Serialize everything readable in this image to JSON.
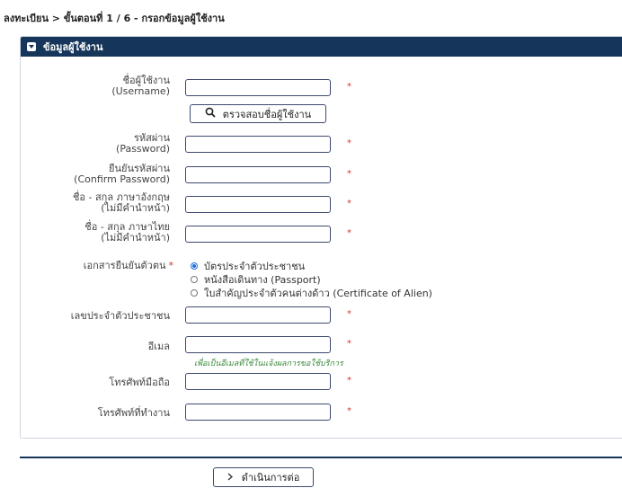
{
  "breadcrumb": "ลงทะเบียน > ขั้นตอนที่ 1 / 6 - กรอกข้อมูลผู้ใช้งาน",
  "panel": {
    "title": "ข้อมูลผู้ใช้งาน"
  },
  "fields": {
    "username": {
      "label_th": "ชื่อผู้ใช้งาน",
      "label_en": "(Username)",
      "value": ""
    },
    "check_button": "ตรวจสอบชื่อผู้ใช้งาน",
    "password": {
      "label_th": "รหัสผ่าน",
      "label_en": "(Password)",
      "value": ""
    },
    "confirm_password": {
      "label_th": "ยืนยันรหัสผ่าน",
      "label_en": "(Confirm Password)",
      "value": ""
    },
    "name_en": {
      "label_1": "ชื่อ - สกุล ภาษาอังกฤษ",
      "label_2": "(ไม่มีคำนำหน้า)",
      "value": ""
    },
    "name_th": {
      "label_1": "ชื่อ - สกุล ภาษาไทย",
      "label_2": "(ไม่มีคำนำหน้า)",
      "value": ""
    },
    "document": {
      "label": "เอกสารยืนยันตัวตน",
      "options": [
        {
          "label": "บัตรประจำตัวประชาชน",
          "selected": true
        },
        {
          "label": "หนังสือเดินทาง (Passport)",
          "selected": false
        },
        {
          "label": "ใบสำคัญประจำตัวคนต่างด้าว (Certificate of Alien)",
          "selected": false
        }
      ]
    },
    "id_number": {
      "label": "เลขประจำตัวประชาชน",
      "value": ""
    },
    "email": {
      "label": "อีเมล",
      "value": "",
      "hint": "เพื่อเป็นอีเมลที่ใช้ในแจ้งผลการขอใช้บริการ"
    },
    "mobile": {
      "label": "โทรศัพท์มือถือ",
      "value": ""
    },
    "work_phone": {
      "label": "โทรศัพท์ที่ทำงาน",
      "value": ""
    }
  },
  "required_mark": "*",
  "next_button": "ดำเนินการต่อ",
  "colors": {
    "header": "#15365a",
    "required": "#d9342b",
    "hint": "#3a8a3a",
    "radio_on": "#1e6fd9"
  },
  "icons": {
    "panel_toggle": "collapse-icon",
    "check": "search-icon",
    "next": "chevron-right-icon"
  }
}
